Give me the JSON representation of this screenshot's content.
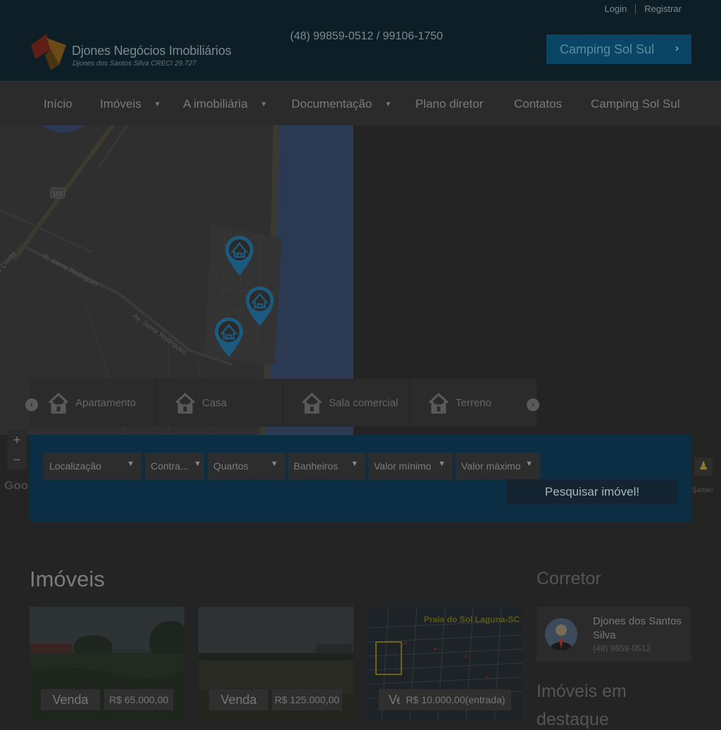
{
  "top_links": {
    "login": "Login",
    "register": "Registrar"
  },
  "brand": {
    "name": "Djones Negócios Imobiliários",
    "subtitle": "Djones dos Santos Silva CRECI 29.727"
  },
  "header": {
    "phone": "(48) 99859-0512 / 99106-1750",
    "cta_label": "Camping Sol Sul",
    "cta_arrow": "›"
  },
  "nav": {
    "items": [
      {
        "label": "Início",
        "dropdown": false
      },
      {
        "label": "Imóveis",
        "dropdown": true
      },
      {
        "label": "A imobiliária",
        "dropdown": true
      },
      {
        "label": "Documentação",
        "dropdown": true
      },
      {
        "label": "Plano diretor",
        "dropdown": false
      },
      {
        "label": "Contatos",
        "dropdown": false
      },
      {
        "label": "Camping Sol Sul",
        "dropdown": false
      }
    ]
  },
  "map": {
    "road_labels": [
      "101",
      "R. Jaime Rodrigues",
      "Av. Jaime Rodrigues",
      "s Covas"
    ],
    "zoom_in": "+",
    "zoom_out": "−",
    "google_logo": "Goo",
    "terms": "n Şartları",
    "marker_count": 3
  },
  "property_types": [
    "Apartamento",
    "Casa",
    "Sala comercial",
    "Terreno"
  ],
  "carousel": {
    "prev": "‹",
    "next": "›"
  },
  "search": {
    "filters": [
      "Localização",
      "Contra...",
      "Quartos",
      "Banheiros",
      "Valor mínimo",
      "Valor máximo"
    ],
    "button_label": "Pesquisar imóvel!"
  },
  "listings": {
    "title": "Imóveis",
    "cards": [
      {
        "status": "Venda",
        "price": "R$ 65.000,00"
      },
      {
        "status": "Venda",
        "price": "R$ 125.000,00"
      },
      {
        "status": "Ve",
        "price": "R$ 10.000,00(entrada)",
        "image_caption": "Praia do Sol  Laguna-SC"
      }
    ]
  },
  "sidebar": {
    "agent_title": "Corretor",
    "agent_name": "Djones dos Santos Silva",
    "agent_phone": "(48) 9859-0512",
    "featured_title_line1": "Imóveis em",
    "featured_title_line2": "destaque"
  },
  "colors": {
    "header_bg": "#0e1e27",
    "search_bg": "#0b2e44",
    "accent": "#0b4566",
    "water": "#2b3a52"
  }
}
